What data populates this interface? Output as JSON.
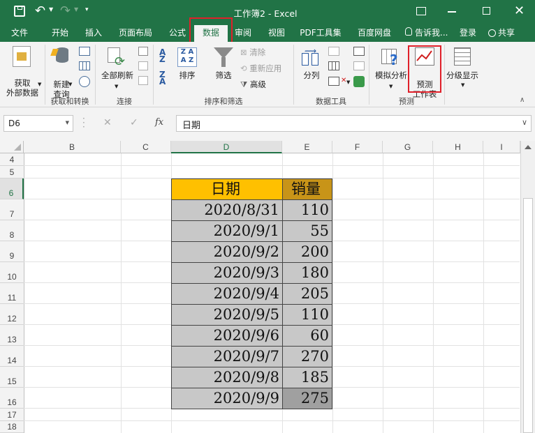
{
  "window": {
    "title": "工作簿2 - Excel"
  },
  "tabs": [
    {
      "label": "文件"
    },
    {
      "label": "开始"
    },
    {
      "label": "插入"
    },
    {
      "label": "页面布局"
    },
    {
      "label": "公式"
    },
    {
      "label": "数据"
    },
    {
      "label": "审阅"
    },
    {
      "label": "视图"
    },
    {
      "label": "PDF工具集"
    },
    {
      "label": "百度网盘"
    }
  ],
  "tell_me": "告诉我...",
  "login": "登录",
  "share": "共享",
  "ribbon": {
    "get_external": "获取\n外部数据",
    "new_query": "新建\n查询",
    "refresh_all": "全部刷新",
    "sort": "排序",
    "filter": "筛选",
    "clear": "清除",
    "reapply": "重新应用",
    "advanced": "高级",
    "text_to_columns": "分列",
    "what_if": "模拟分析",
    "forecast_sheet": "预测\n工作表",
    "outline": "分级显示",
    "groups": {
      "get_transform": "获取和转换",
      "connections": "连接",
      "sort_filter": "排序和筛选",
      "data_tools": "数据工具",
      "forecast": "预测"
    }
  },
  "formula_bar": {
    "name_box": "D6",
    "fx": "fx",
    "formula": "日期"
  },
  "columns": [
    "B",
    "C",
    "D",
    "E",
    "F",
    "G",
    "H",
    "I"
  ],
  "rows": [
    "4",
    "5",
    "6",
    "7",
    "8",
    "9",
    "10",
    "11",
    "12",
    "13",
    "14",
    "15",
    "16",
    "17",
    "18"
  ],
  "table": {
    "header": {
      "date": "日期",
      "sales": "销量"
    },
    "rows": [
      {
        "date": "2020/8/31",
        "sales": "110"
      },
      {
        "date": "2020/9/1",
        "sales": "55"
      },
      {
        "date": "2020/9/2",
        "sales": "200"
      },
      {
        "date": "2020/9/3",
        "sales": "180"
      },
      {
        "date": "2020/9/4",
        "sales": "205"
      },
      {
        "date": "2020/9/5",
        "sales": "110"
      },
      {
        "date": "2020/9/6",
        "sales": "60"
      },
      {
        "date": "2020/9/7",
        "sales": "270"
      },
      {
        "date": "2020/9/8",
        "sales": "185"
      },
      {
        "date": "2020/9/9",
        "sales": "275"
      }
    ]
  },
  "colors": {
    "excel_green": "#217346",
    "header_date": "#ffc000",
    "header_sales": "#c89418",
    "cell_fill": "#c8c8c8",
    "highlight_red": "#e0202a"
  }
}
